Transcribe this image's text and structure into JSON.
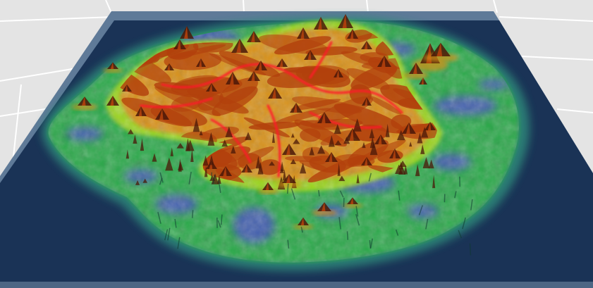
{
  "scene": {
    "type": "3d-terrain-heightmap-viewport",
    "colors": {
      "floor": "#e4e4e4",
      "floor_grid": "#ffffff",
      "water_plane": "#1a3356",
      "frame_rim": "#5f7a98",
      "frame_side": "#4d6684",
      "shallow_shelf": "#2f8a7a",
      "lowland": "#2aa84a",
      "midland": "#9ad41c",
      "upland": "#d89018",
      "highland": "#b2400c",
      "peak_shadow": "#4a1808",
      "river": "#ff1a28",
      "depression": "#4c3ed8"
    }
  }
}
